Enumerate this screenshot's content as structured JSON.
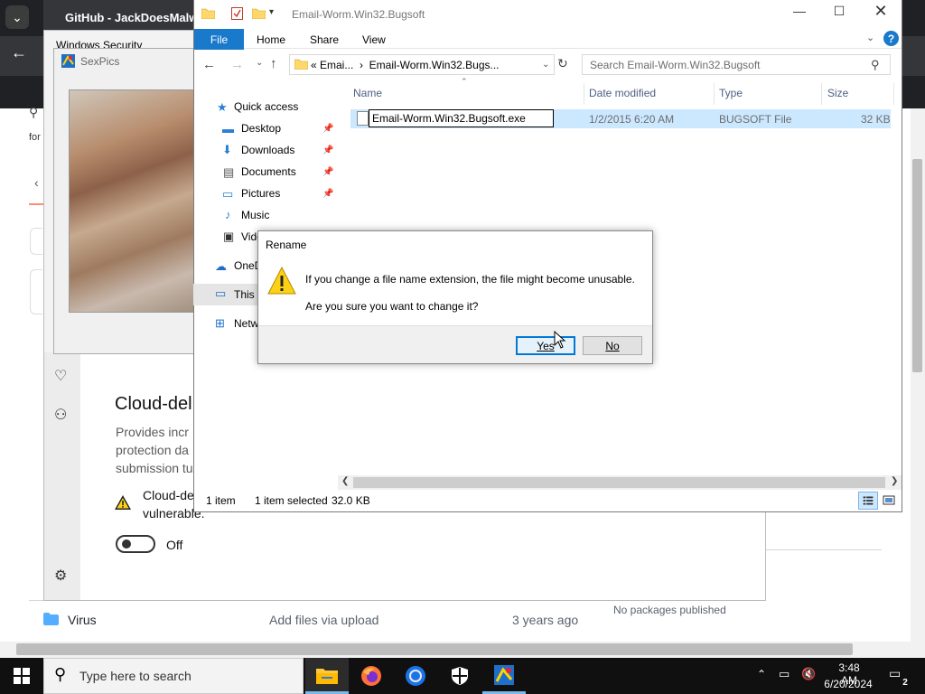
{
  "browser": {
    "tab_title": "GitHub - JackDoesMalware",
    "partial_text_for": "for",
    "repo_row": {
      "name": "Virus",
      "message": "Add files via upload",
      "date": "3 years ago"
    },
    "no_packages": "No packages published"
  },
  "windows_security": {
    "title": "Windows Security",
    "heading": "Cloud-del",
    "description": "Provides incr\nprotection da\nsubmission tu",
    "warning_text": "Cloud-de\nvulnerable.",
    "toggle_label": "Off"
  },
  "sexpics": {
    "title": "SexPics"
  },
  "explorer": {
    "title": "Email-Worm.Win32.Bugsoft",
    "ribbon_tabs": [
      "File",
      "Home",
      "Share",
      "View"
    ],
    "address": "« Emai...  ›  Email-Worm.Win32.Bugs...",
    "search_placeholder": "Search Email-Worm.Win32.Bugsoft",
    "nav_items": [
      "Quick access",
      "Desktop",
      "Downloads",
      "Documents",
      "Pictures",
      "Music",
      "Vide",
      "OneD",
      "This P",
      "Netw"
    ],
    "columns": {
      "name": "Name",
      "date": "Date modified",
      "type": "Type",
      "size": "Size"
    },
    "file": {
      "name_edit": "Email-Worm.Win32.Bugsoft.exe",
      "date": "1/2/2015 6:20 AM",
      "type": "BUGSOFT File",
      "size": "32 KB"
    },
    "status": {
      "count": "1 item",
      "selected": "1 item selected",
      "size": "32.0 KB"
    }
  },
  "dialog": {
    "title": "Rename",
    "message1": "If you change a file name extension, the file might become unusable.",
    "message2": "Are you sure you want to change it?",
    "yes": "Yes",
    "no": "No"
  },
  "taskbar": {
    "search_placeholder": "Type here to search",
    "time": "3:48 AM",
    "date": "6/20/2024",
    "notifications": "2"
  },
  "colors": {
    "accent": "#0078d7",
    "file_tab": "#1979ca",
    "selection": "#cce8ff"
  }
}
